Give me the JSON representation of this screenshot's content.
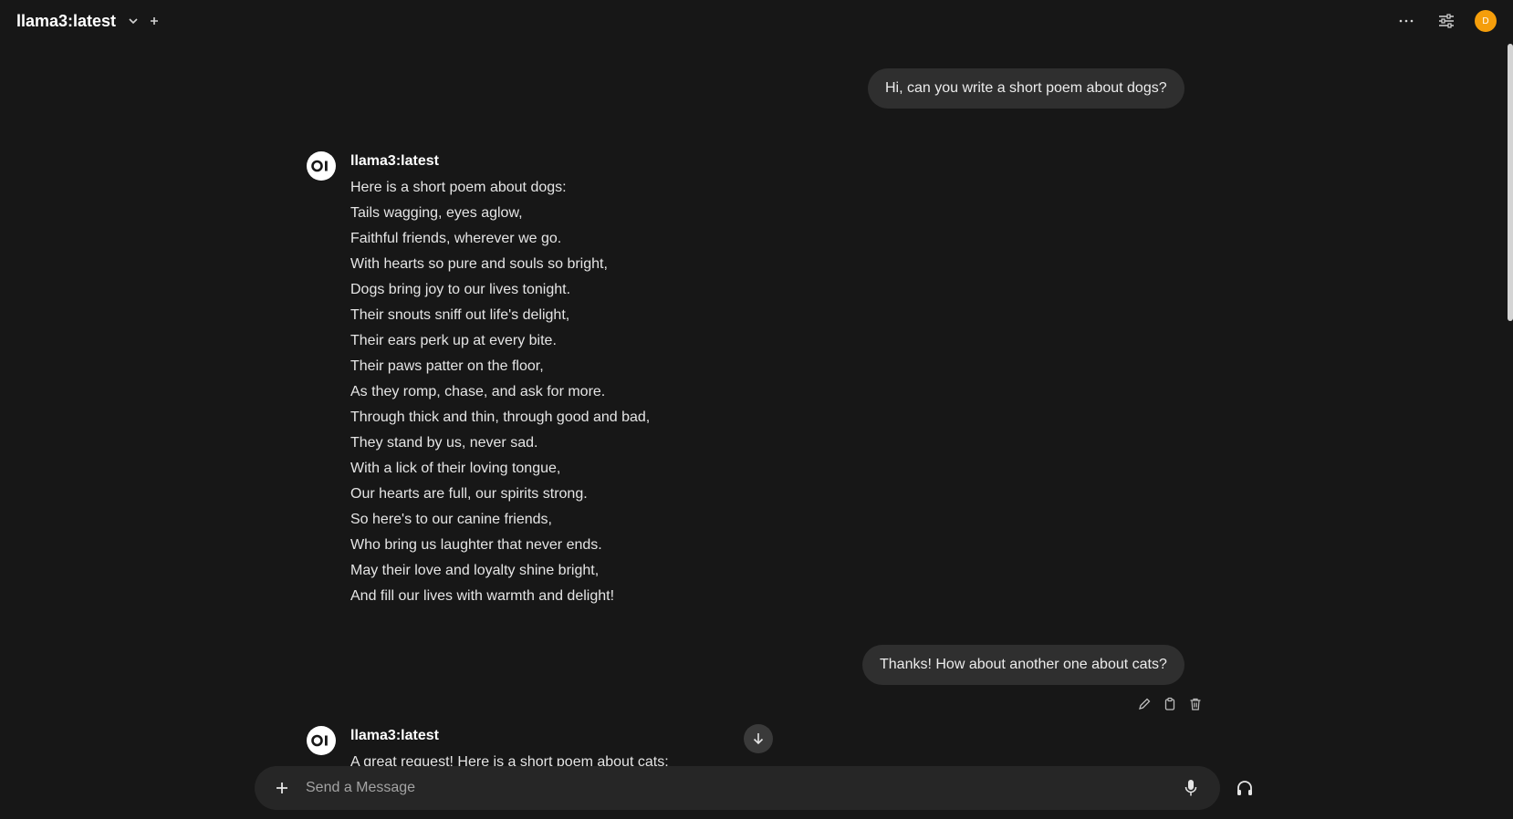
{
  "header": {
    "model_name": "llama3:latest",
    "icons": {
      "dropdown": "chevron-down-icon",
      "new_chat": "plus-icon",
      "more": "more-horizontal-icon",
      "controls": "sliders-icon"
    },
    "avatar_initial": "D",
    "avatar_color": "#f59e0b"
  },
  "conversation": {
    "user_message_1": "Hi, can you write a short poem about dogs?",
    "assistant_1": {
      "name": "llama3:latest",
      "lines": [
        "Here is a short poem about dogs:",
        "Tails wagging, eyes aglow,",
        "Faithful friends, wherever we go.",
        "With hearts so pure and souls so bright,",
        "Dogs bring joy to our lives tonight.",
        "Their snouts sniff out life's delight,",
        "Their ears perk up at every bite.",
        "Their paws patter on the floor,",
        "As they romp, chase, and ask for more.",
        "Through thick and thin, through good and bad,",
        "They stand by us, never sad.",
        "With a lick of their loving tongue,",
        "Our hearts are full, our spirits strong.",
        "So here's to our canine friends,",
        "Who bring us laughter that never ends.",
        "May their love and loyalty shine bright,",
        "And fill our lives with warmth and delight!"
      ]
    },
    "user_message_2": "Thanks! How about another one about cats?",
    "message_actions": [
      "edit-icon",
      "copy-icon",
      "delete-icon"
    ],
    "assistant_2": {
      "name": "llama3:latest",
      "lines": [
        "A great request! Here is a short poem about cats:"
      ]
    }
  },
  "composer": {
    "placeholder": "Send a Message"
  },
  "colors": {
    "background": "#171717",
    "bubble": "#2f2f2f",
    "composer": "#262626"
  }
}
